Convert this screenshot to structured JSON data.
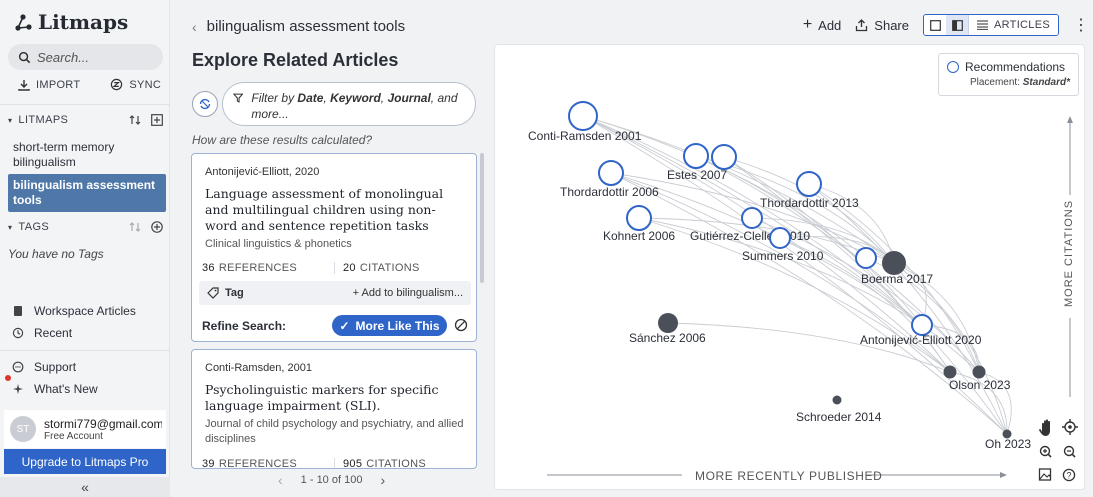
{
  "app": {
    "name": "Litmaps"
  },
  "sidebar": {
    "search_placeholder": "Search...",
    "import_label": "IMPORT",
    "sync_label": "SYNC",
    "litmaps_header": "LITMAPS",
    "litmaps": [
      {
        "label": "short-term memory bilingualism",
        "active": false
      },
      {
        "label": "bilingualism assessment tools",
        "active": true
      }
    ],
    "tags_header": "TAGS",
    "no_tags": "You have no Tags",
    "workspace_articles": "Workspace Articles",
    "recent": "Recent",
    "support": "Support",
    "whats_new": "What's New",
    "account": {
      "initials": "ST",
      "email": "stormi779@gmail.com",
      "plan": "Free Account"
    },
    "upgrade_label": "Upgrade to Litmaps Pro",
    "collapse_label": "«"
  },
  "header": {
    "breadcrumb": "bilingualism assessment tools",
    "add_label": "Add",
    "share_label": "Share",
    "articles_label": "ARTICLES"
  },
  "panel": {
    "title": "Explore Related Articles",
    "filter_prefix": "Filter by ",
    "filter_date": "Date",
    "filter_keyword": "Keyword",
    "filter_journal": "Journal",
    "filter_suffix": ", and more...",
    "how_calculated": "How are these results calculated?",
    "cards": [
      {
        "author_year": "Antonijević-Elliott, 2020",
        "title": "Language assessment of monolingual and multilingual children using non-word and sentence repetition tasks",
        "journal": "Clinical linguistics & phonetics",
        "references": "36",
        "citations": "20",
        "references_label": "REFERENCES",
        "citations_label": "CITATIONS",
        "tag_label": "Tag",
        "add_to_label": "+ Add to bilingualism...",
        "refine_label": "Refine Search:",
        "more_like_label": "More Like This"
      },
      {
        "author_year": "Conti-Ramsden, 2001",
        "title": "Psycholinguistic markers for specific language impairment (SLI).",
        "journal": "Journal of child psychology and psychiatry, and allied disciplines",
        "references": "39",
        "citations": "905",
        "references_label": "REFERENCES",
        "citations_label": "CITATIONS"
      }
    ],
    "pager": {
      "prev": "‹",
      "range": "1 - 10 of 100",
      "next": "›"
    }
  },
  "map": {
    "legend_title": "Recommendations",
    "placement_label": "Placement:",
    "placement_value": "Standard*",
    "y_axis_label": "MORE CITATIONS",
    "x_axis_label": "MORE RECENTLY PUBLISHED",
    "colors": {
      "recommendation": "#2f64c8",
      "seed": "#4a4f5a",
      "edge": "#c9ccd2"
    },
    "nodes": [
      {
        "id": "conti",
        "label": "Conti-Ramsden 2001",
        "kind": "rec",
        "size": "large"
      },
      {
        "id": "thor2006",
        "label": "Thordardottir 2006",
        "kind": "rec",
        "size": "medium"
      },
      {
        "id": "estes",
        "label": "Estes 2007",
        "kind": "rec",
        "size": "medium"
      },
      {
        "id": "estes_b",
        "label": "",
        "kind": "rec",
        "size": "medium"
      },
      {
        "id": "thor2013",
        "label": "Thordardottir 2013",
        "kind": "rec",
        "size": "medium"
      },
      {
        "id": "kohnert",
        "label": "Kohnert 2006",
        "kind": "rec",
        "size": "medium"
      },
      {
        "id": "gutierrez",
        "label": "Gutiérrez-Clellen 2010",
        "kind": "rec",
        "size": "small"
      },
      {
        "id": "summers",
        "label": "Summers 2010",
        "kind": "rec",
        "size": "small"
      },
      {
        "id": "boerma_rec",
        "label": "",
        "kind": "rec",
        "size": "small"
      },
      {
        "id": "boerma",
        "label": "Boerma 2017",
        "kind": "seed",
        "size": "medium"
      },
      {
        "id": "sanchez",
        "label": "Sánchez 2006",
        "kind": "seed",
        "size": "small"
      },
      {
        "id": "antonijevic",
        "label": "Antonijević-Elliott 2020",
        "kind": "rec",
        "size": "small"
      },
      {
        "id": "olson_a",
        "label": "",
        "kind": "seed",
        "size": "tiny"
      },
      {
        "id": "olson",
        "label": "Olson 2023",
        "kind": "seed",
        "size": "tiny"
      },
      {
        "id": "schroeder",
        "label": "Schroeder 2014",
        "kind": "seed",
        "size": "xtiny"
      },
      {
        "id": "oh",
        "label": "Oh 2023",
        "kind": "seed",
        "size": "xtiny"
      }
    ]
  }
}
